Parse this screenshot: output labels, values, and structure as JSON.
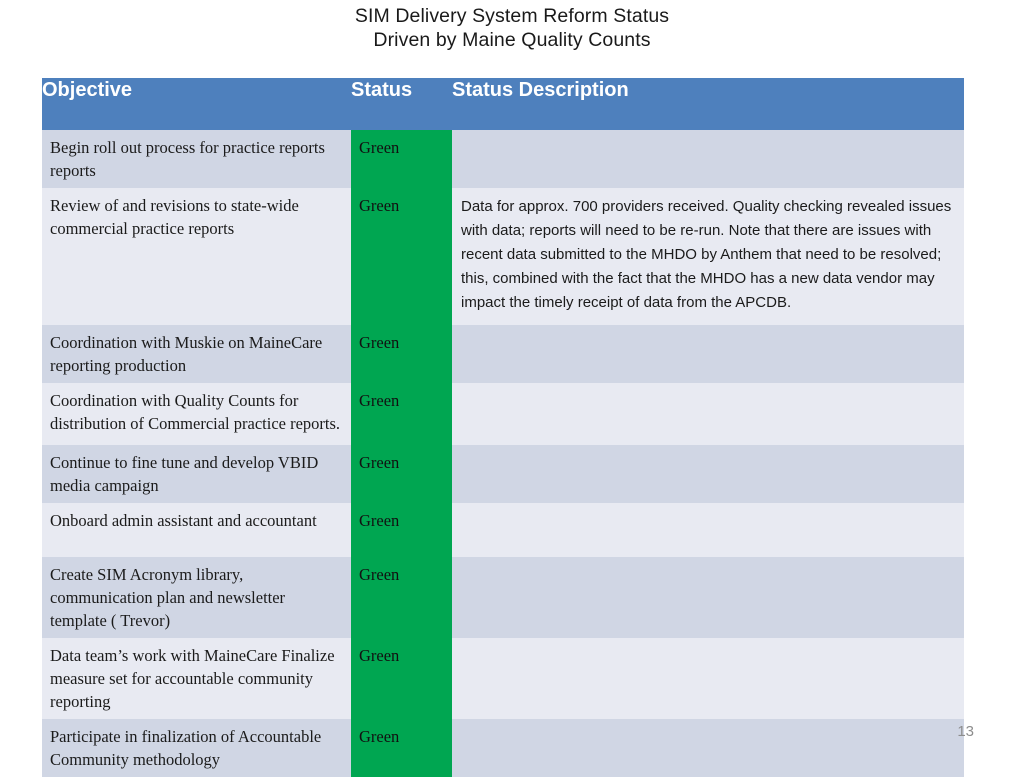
{
  "slide": {
    "title_line1": "SIM Delivery System Reform Status",
    "title_line2": "Driven by Maine Quality Counts",
    "page_number": "13"
  },
  "colors": {
    "header_blue": "#4E80BD",
    "status_green": "#00A651",
    "row_shade_dark": "#d0d6e4",
    "row_shade_light": "#e8eaf2",
    "page_number_gray": "#8d8d8d"
  },
  "table": {
    "headers": {
      "objective": "Objective",
      "status": "Status",
      "description": "Status Description"
    },
    "rows": [
      {
        "objective": "Begin roll out process for practice reports reports",
        "status": "Green",
        "description": ""
      },
      {
        "objective": "Review of and revisions to state-wide commercial practice reports",
        "status": "Green",
        "description": "Data for approx. 700 providers received. Quality checking revealed issues with data; reports will need to be re-run. Note that there are issues with recent data submitted to the MHDO by Anthem that need to be resolved; this, combined with the fact that the MHDO has a new data vendor may impact the timely receipt of data from the APCDB."
      },
      {
        "objective": "Coordination with Muskie on MaineCare reporting production",
        "status": "Green",
        "description": ""
      },
      {
        "objective": "Coordination with Quality Counts for distribution of Commercial practice reports.",
        "status": "Green",
        "description": ""
      },
      {
        "objective": "Continue to fine tune and develop VBID media campaign",
        "status": "Green",
        "description": ""
      },
      {
        "objective": "Onboard admin assistant and accountant",
        "status": "Green",
        "description": ""
      },
      {
        "objective": "Create SIM Acronym library, communication plan and newsletter template ( Trevor)",
        "status": "Green",
        "description": ""
      },
      {
        "objective": "Data team’s work with MaineCare Finalize measure set for accountable community reporting",
        "status": "Green",
        "description": ""
      },
      {
        "objective": "Participate in finalization of Accountable Community methodology",
        "status": "Green",
        "description": ""
      }
    ]
  }
}
